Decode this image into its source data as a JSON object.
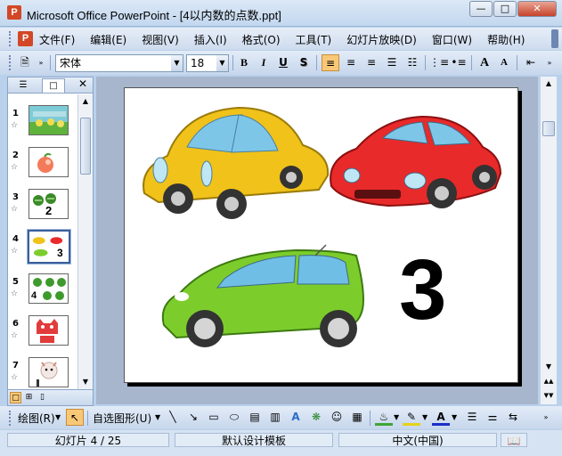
{
  "window": {
    "title": "Microsoft Office PowerPoint - [4以内数的点数.ppt]",
    "app_icon": "P",
    "buttons": [
      "minimize",
      "maximize",
      "close"
    ]
  },
  "menubar": {
    "items": [
      "文件(F)",
      "编辑(E)",
      "视图(V)",
      "插入(I)",
      "格式(O)",
      "工具(T)",
      "幻灯片放映(D)",
      "窗口(W)",
      "帮助(H)"
    ]
  },
  "toolbar": {
    "font_name": "宋体",
    "font_size": "18",
    "bold": "B",
    "italic": "I",
    "underline": "U",
    "shadow": "S",
    "grow_font": "A",
    "shrink_font": "A"
  },
  "slides_pane": {
    "thumbnails": [
      {
        "number": "1",
        "label": ""
      },
      {
        "number": "2",
        "label": ""
      },
      {
        "number": "3",
        "label": "2"
      },
      {
        "number": "4",
        "label": "3"
      },
      {
        "number": "5",
        "label": "4"
      },
      {
        "number": "6",
        "label": ""
      },
      {
        "number": "7",
        "label": ""
      }
    ],
    "selected_index": 3
  },
  "slide": {
    "number_text": "3",
    "cars": [
      {
        "name": "yellow car",
        "color": "#f0c21a"
      },
      {
        "name": "red car",
        "color": "#e82a2a"
      },
      {
        "name": "green car",
        "color": "#7ccd2c"
      }
    ]
  },
  "drawing_toolbar": {
    "draw_label": "绘图(R)",
    "autoshapes_label": "自选图形(U)"
  },
  "statusbar": {
    "slide_position": "幻灯片 4 / 25",
    "design_template": "默认设计模板",
    "language": "中文(中国)"
  }
}
